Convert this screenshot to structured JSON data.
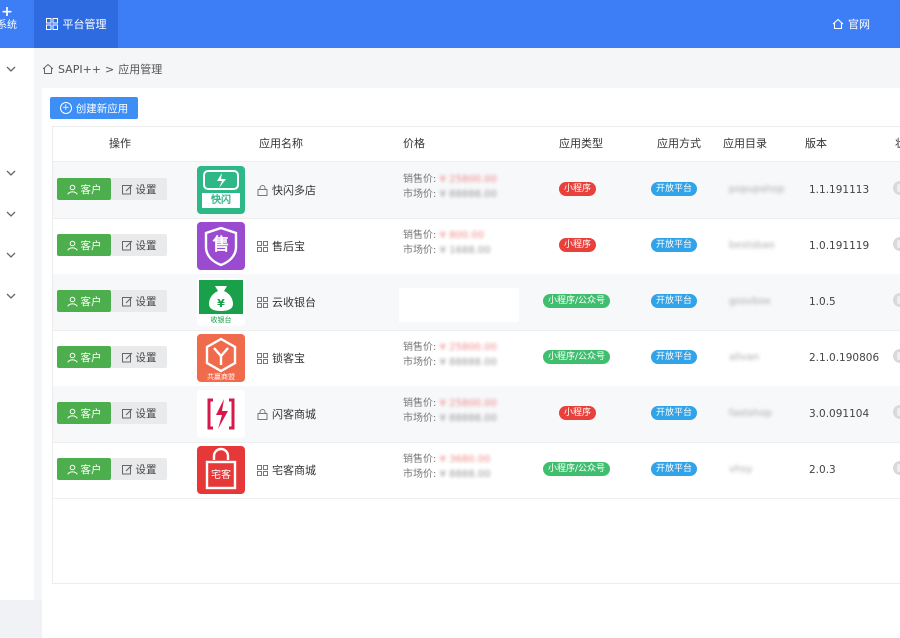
{
  "header": {
    "brand_plus": "+",
    "brand_text": "系统",
    "active_nav": "平台管理",
    "official_site": "官网"
  },
  "breadcrumb": {
    "home": "SAPI++",
    "separator": ">",
    "current": "应用管理"
  },
  "toolbar": {
    "create_label": "创建新应用"
  },
  "table": {
    "headers": [
      "操作",
      "应用名称",
      "价格",
      "应用类型",
      "应用方式",
      "应用目录",
      "版本",
      "状"
    ],
    "client_label": "客户",
    "settings_label": "设置",
    "price_sell_label": "销售价:",
    "price_market_label": "市场价:",
    "rows": [
      {
        "icon": "kuaishan-icon",
        "icon_text": "快闪",
        "name_icon": "lock-icon",
        "name": "快闪多店",
        "sell": "¥ 25800.00",
        "market": "¥ 88888.00",
        "type": "小程序",
        "type_color": "red",
        "mode": "开放平台",
        "dir": "popupshop",
        "version": "1.1.191113"
      },
      {
        "icon": "shou-icon",
        "icon_text": "售",
        "name_icon": "grid-icon",
        "name": "售后宝",
        "sell": "¥ 800.00",
        "market": "¥ 1688.00",
        "type": "小程序",
        "type_color": "red",
        "mode": "开放平台",
        "dir": "bestsbao",
        "version": "1.0.191119"
      },
      {
        "icon": "money-bag-icon",
        "icon_text": "收银台",
        "name_icon": "grid-icon",
        "name": "云收银台",
        "sell": "",
        "market": "",
        "type": "小程序/公众号",
        "type_color": "green",
        "mode": "开放平台",
        "dir": "gosvbox",
        "version": "1.0.5"
      },
      {
        "icon": "hexagon-y-icon",
        "icon_text": "共赢商盟",
        "name_icon": "grid-icon",
        "name": "锁客宝",
        "sell": "¥ 25800.00",
        "market": "¥ 88888.00",
        "type": "小程序/公众号",
        "type_color": "green",
        "mode": "开放平台",
        "dir": "allvan",
        "version": "2.1.0.190806"
      },
      {
        "icon": "lightning-bracket-icon",
        "icon_text": "",
        "name_icon": "lock-icon",
        "name": "闪客商城",
        "sell": "¥ 25800.00",
        "market": "¥ 88888.00",
        "type": "小程序",
        "type_color": "red",
        "mode": "开放平台",
        "dir": "fastshop",
        "version": "3.0.091104"
      },
      {
        "icon": "shopping-bag-icon",
        "icon_text": "宅客",
        "name_icon": "grid-icon",
        "name": "宅客商城",
        "sell": "¥ 3680.00",
        "market": "¥ 8888.00",
        "type": "小程序/公众号",
        "type_color": "green",
        "mode": "开放平台",
        "dir": "vhsy",
        "version": "2.0.3"
      }
    ]
  },
  "colors": {
    "topbar": "#3d7ef7",
    "primary_button": "#3d8ef5",
    "client_button": "#4cae4c",
    "badge_red": "#e8403a",
    "badge_green": "#3fbf6d",
    "badge_blue": "#31a3e8"
  }
}
